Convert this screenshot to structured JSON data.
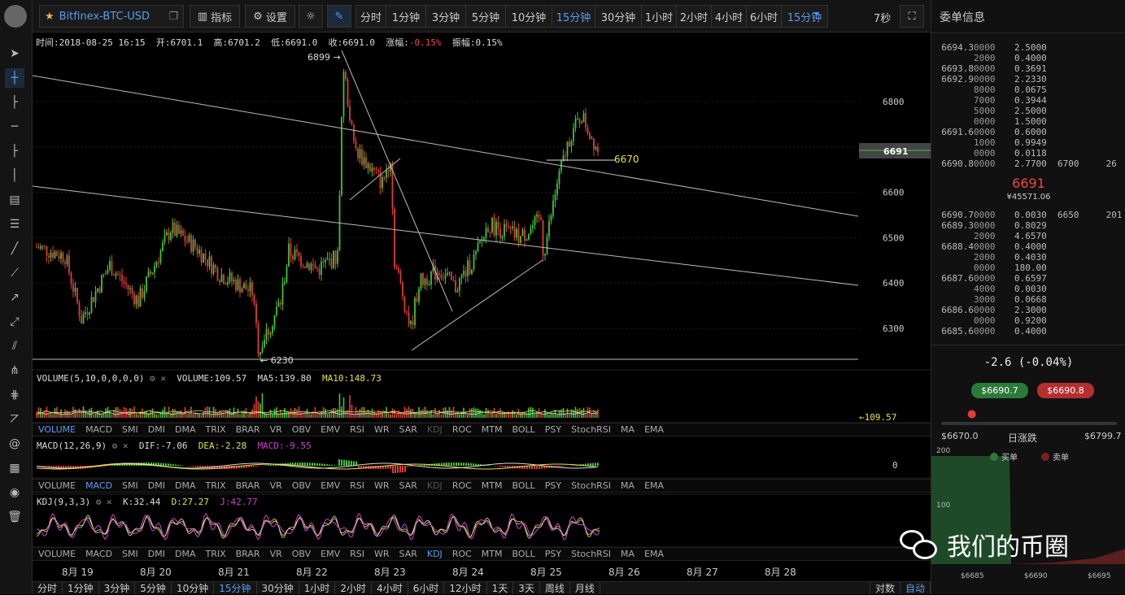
{
  "toolbar": {
    "pair": "Bitfinex-BTC-USD",
    "indicator": "指标",
    "settings": "设置",
    "periods": [
      "分时",
      "1分钟",
      "3分钟",
      "5分钟",
      "10分钟",
      "15分钟",
      "30分钟",
      "1小时",
      "2小时",
      "4小时",
      "6小时",
      "15分钟"
    ],
    "selected_period": "15分钟",
    "countdown": "7秒"
  },
  "info": {
    "time": "时间:2018-08-25 16:15",
    "open": "开:6701.1",
    "high": "高:6701.2",
    "low": "低:6691.0",
    "close": "收:6691.0",
    "change_label": "涨幅:",
    "change": "-0.15%",
    "amplitude": "振幅:0.15%"
  },
  "main_chart": {
    "yticks": [
      "6800",
      "6700",
      "6600",
      "6500",
      "6400",
      "6300"
    ],
    "last_price": "6691",
    "marker_6670": "6670",
    "high_marker": "6899 →",
    "low_marker": "← 6230"
  },
  "volume": {
    "label": "VOLUME(5,10,0,0,0,0)",
    "vol": "VOLUME:109.57",
    "ma5": "MA5:139.80",
    "ma10": "MA10:148.73",
    "right": "←109.57"
  },
  "macd": {
    "label": "MACD(12,26,9)",
    "dif": "DIF:-7.06",
    "dea": "DEA:-2.28",
    "macd": "MACD:-9.55",
    "zero": "0"
  },
  "kdj": {
    "label": "KDJ(9,3,3)",
    "k": "K:32.44",
    "d": "D:27.27",
    "j": "J:42.77"
  },
  "indicators": [
    "VOLUME",
    "MACD",
    "SMI",
    "DMI",
    "DMA",
    "TRIX",
    "BRAR",
    "VR",
    "OBV",
    "EMV",
    "RSI",
    "WR",
    "SAR",
    "KDJ",
    "ROC",
    "MTM",
    "BOLL",
    "PSY",
    "StochRSI",
    "MA",
    "EMA"
  ],
  "dates": [
    "8月 19",
    "8月 20",
    "8月 21",
    "8月 22",
    "8月 23",
    "8月 24",
    "8月 25",
    "8月 26",
    "8月 27",
    "8月 28"
  ],
  "bottom": {
    "periods": [
      "分时",
      "1分钟",
      "3分钟",
      "5分钟",
      "10分钟",
      "15分钟",
      "30分钟",
      "1小时",
      "2小时",
      "4小时",
      "6小时",
      "12小时",
      "1天",
      "3天",
      "周线",
      "月线"
    ],
    "selected": "15分钟",
    "right1": "对数",
    "right2": "自动"
  },
  "orderbook": {
    "title": "委单信息",
    "asks": [
      [
        "6694.3",
        "0000",
        "2.5000"
      ],
      [
        "",
        "2000",
        "0.4000"
      ],
      [
        "6693.8",
        "0000",
        "0.3691"
      ],
      [
        "6692.9",
        "0000",
        "2.2330"
      ],
      [
        "",
        "8000",
        "0.0675"
      ],
      [
        "",
        "7000",
        "0.3944"
      ],
      [
        "",
        "5000",
        "2.5000"
      ],
      [
        "",
        "0000",
        "1.5000"
      ],
      [
        "6691.6",
        "0000",
        "0.6000"
      ],
      [
        "",
        "1000",
        "0.9949"
      ],
      [
        "",
        "0000",
        "0.0118"
      ],
      [
        "6690.8",
        "0000",
        "2.7700"
      ]
    ],
    "ask_ext": [
      "6700",
      "26"
    ],
    "price": "6691",
    "sub": "¥45571.06",
    "bids": [
      [
        "6690.7",
        "0000",
        "0.0030"
      ],
      [
        "6689.3",
        "0000",
        "0.8029"
      ],
      [
        "",
        "2000",
        "4.6570"
      ],
      [
        "6688.4",
        "0000",
        "0.4000"
      ],
      [
        "",
        "2000",
        "0.4030"
      ],
      [
        "",
        "0000",
        "180.00"
      ],
      [
        "6687.6",
        "0000",
        "0.6597"
      ],
      [
        "",
        "4000",
        "0.0030"
      ],
      [
        "",
        "3000",
        "0.0668"
      ],
      [
        "6686.6",
        "0000",
        "2.3000"
      ],
      [
        "",
        "0000",
        "0.9200"
      ],
      [
        "6685.6",
        "0000",
        "0.4000"
      ]
    ],
    "bid_ext": [
      "6650",
      "201"
    ],
    "change": "-2.6 (-0.04%)",
    "buy_price": "$6690.7",
    "sell_price": "$6690.8",
    "range_low": "$6670.0",
    "range_label": "日涨跌",
    "range_high": "$6799.7",
    "depth_buy": "买单",
    "depth_sell": "卖单",
    "depth_y": [
      "200",
      "100"
    ],
    "depth_x": [
      "$6685",
      "$6690",
      "$6695"
    ]
  },
  "watermark": "我们的币圈",
  "colors": {
    "up": "#3ec43e",
    "down": "#e33a3a",
    "accent": "#5a9cf0"
  }
}
